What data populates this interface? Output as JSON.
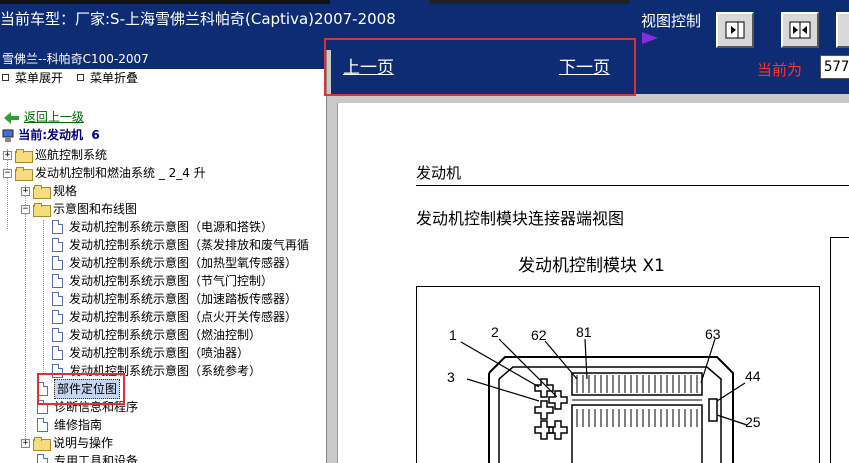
{
  "topbar": {
    "title": "当前车型：厂家:S-上海雪佛兰科帕奇(Captiva)2007-2008",
    "view_control_label": "视图控制",
    "buttons": [
      "panel-toggle-icon",
      "collapse-both-icon",
      "expand-icon"
    ]
  },
  "leftpanel": {
    "header": "雪佛兰--科帕奇C100-2007",
    "menu_expand": "菜单展开",
    "menu_collapse": "菜单折叠",
    "back": "返回上一级",
    "current_prefix": "当前:发动机",
    "current_count": "6",
    "tree": [
      {
        "label": "巡航控制系统",
        "type": "folder",
        "expanded": false
      },
      {
        "label": "发动机控制和燃油系统 _ 2_4 升",
        "type": "folder",
        "expanded": true
      },
      {
        "label": "规格",
        "type": "folder",
        "expanded": false
      },
      {
        "label": "示意图和布线图",
        "type": "folder",
        "expanded": true
      },
      {
        "label": "发动机控制系统示意图（电源和搭铁）",
        "type": "doc"
      },
      {
        "label": "发动机控制系统示意图（蒸发排放和废气再循",
        "type": "doc"
      },
      {
        "label": "发动机控制系统示意图（加热型氧传感器）",
        "type": "doc"
      },
      {
        "label": "发动机控制系统示意图（节气门控制）",
        "type": "doc"
      },
      {
        "label": "发动机控制系统示意图（加速踏板传感器）",
        "type": "doc"
      },
      {
        "label": "发动机控制系统示意图（点火开关传感器）",
        "type": "doc"
      },
      {
        "label": "发动机控制系统示意图（燃油控制）",
        "type": "doc"
      },
      {
        "label": "发动机控制系统示意图（喷油器）",
        "type": "doc"
      },
      {
        "label": "发动机控制系统示意图（系统参考）",
        "type": "doc"
      },
      {
        "label": "部件定位图",
        "type": "doc",
        "selected": true
      },
      {
        "label": "诊断信息和程序",
        "type": "doc"
      },
      {
        "label": "维修指南",
        "type": "doc"
      },
      {
        "label": "说明与操作",
        "type": "folder",
        "expanded": false
      },
      {
        "label": "专用工具和设备",
        "type": "doc"
      }
    ]
  },
  "navbar": {
    "prev": "上一页",
    "next": "下一页",
    "current_label": "当前为",
    "page_value": "577"
  },
  "document": {
    "section": "发动机",
    "heading": "发动机控制模块连接器端视图",
    "diagram_title": "发动机控制模块 X1",
    "pins": [
      "1",
      "2",
      "62",
      "81",
      "63",
      "3",
      "44",
      "25"
    ]
  },
  "colors": {
    "header_blue": "#0e2c74",
    "highlight_red": "#e03030",
    "current_red": "#ff3030"
  }
}
